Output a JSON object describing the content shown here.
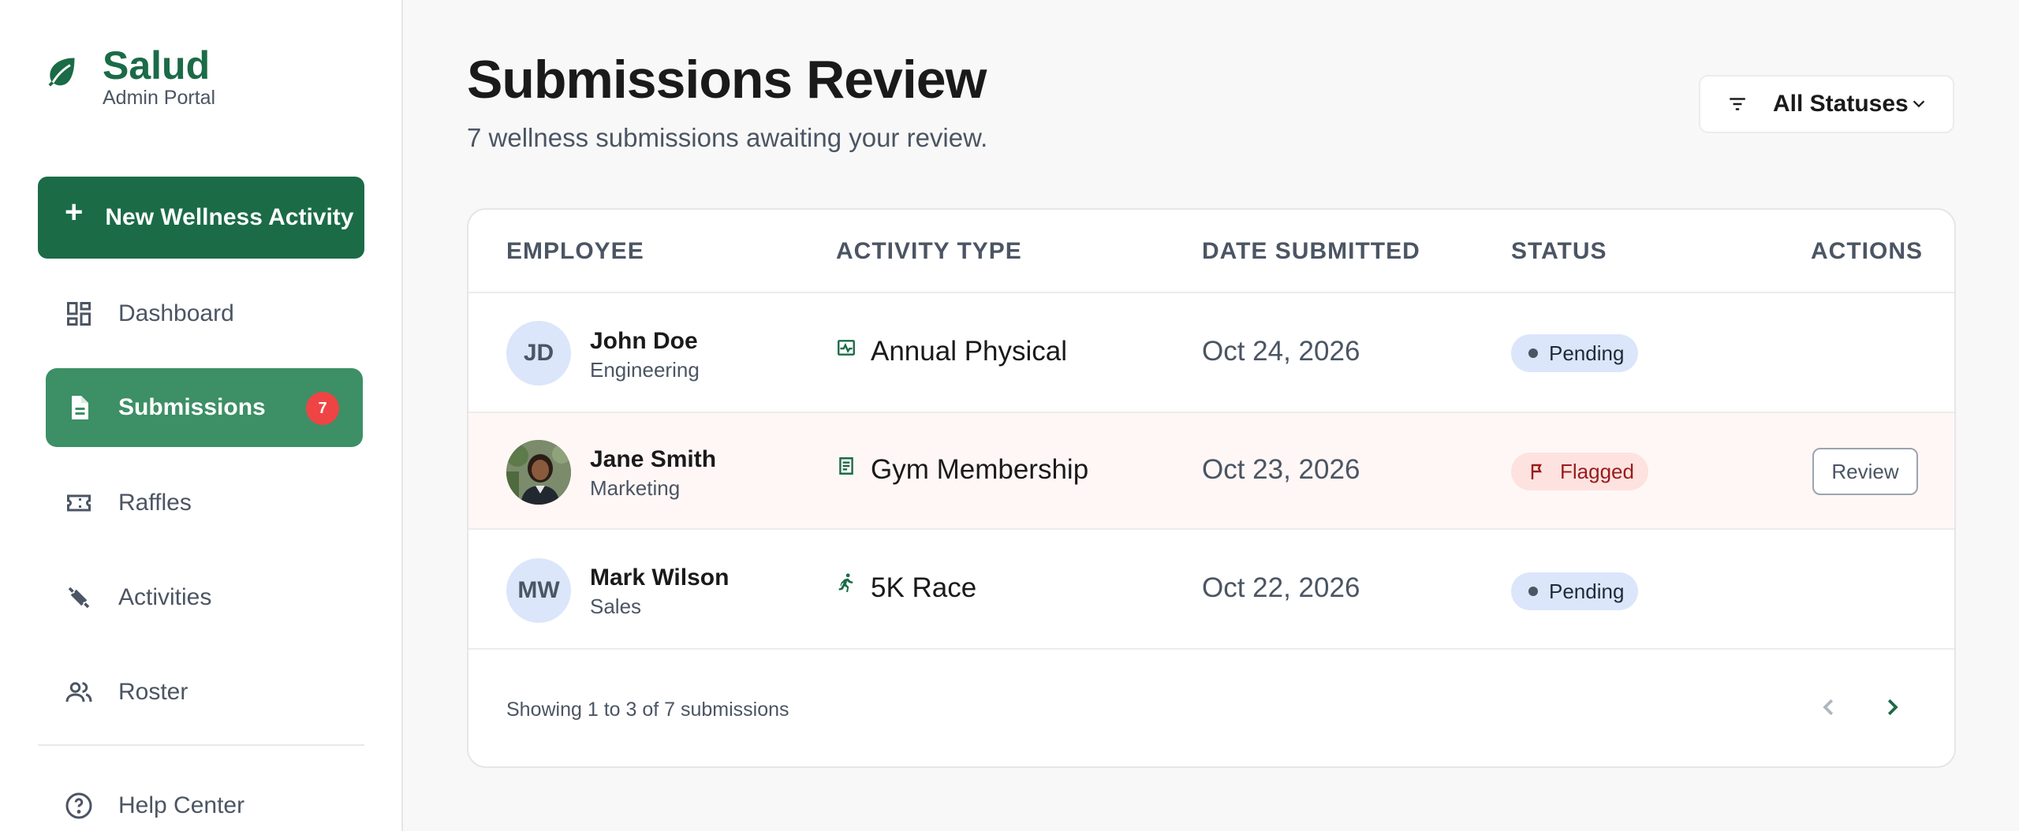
{
  "brand": {
    "name": "Salud",
    "subtitle": "Admin Portal",
    "icon": "leaf-icon"
  },
  "sidebar": {
    "new_button": {
      "label": "New Wellness Activity",
      "icon": "plus-icon"
    },
    "items": [
      {
        "label": "Dashboard",
        "icon": "dashboard-icon",
        "active": false
      },
      {
        "label": "Submissions",
        "icon": "document-icon",
        "active": true,
        "badge": "7"
      },
      {
        "label": "Raffles",
        "icon": "ticket-icon",
        "active": false
      },
      {
        "label": "Activities",
        "icon": "dumbbell-icon",
        "active": false
      },
      {
        "label": "Roster",
        "icon": "people-icon",
        "active": false
      }
    ],
    "help": {
      "label": "Help Center",
      "icon": "help-circle-icon"
    }
  },
  "header": {
    "title": "Submissions Review",
    "subtitle": "7 wellness submissions awaiting your review."
  },
  "filter": {
    "label": "All Statuses",
    "icon": "filter-icon"
  },
  "table": {
    "columns": [
      "EMPLOYEE",
      "ACTIVITY TYPE",
      "DATE SUBMITTED",
      "STATUS",
      "ACTIONS"
    ],
    "rows": [
      {
        "initials": "JD",
        "name": "John Doe",
        "department": "Engineering",
        "activity": "Annual Physical",
        "activity_icon": "health-monitor-icon",
        "date": "Oct 24, 2026",
        "status": "Pending",
        "action": ""
      },
      {
        "initials": "",
        "name": "Jane Smith",
        "department": "Marketing",
        "activity": "Gym Membership",
        "activity_icon": "receipt-icon",
        "date": "Oct 23, 2026",
        "status": "Flagged",
        "action": "Review"
      },
      {
        "initials": "MW",
        "name": "Mark Wilson",
        "department": "Sales",
        "activity": "5K Race",
        "activity_icon": "runner-icon",
        "date": "Oct 22, 2026",
        "status": "Pending",
        "action": ""
      }
    ],
    "footer": "Showing 1 to 3 of 7 submissions"
  },
  "colors": {
    "brand": "#1b6b47",
    "active_nav": "#3d8f66",
    "badge": "#ef4444",
    "pending_bg": "#dbe6fb",
    "flag_bg": "#fde2e0",
    "flag_text": "#991b1b"
  }
}
